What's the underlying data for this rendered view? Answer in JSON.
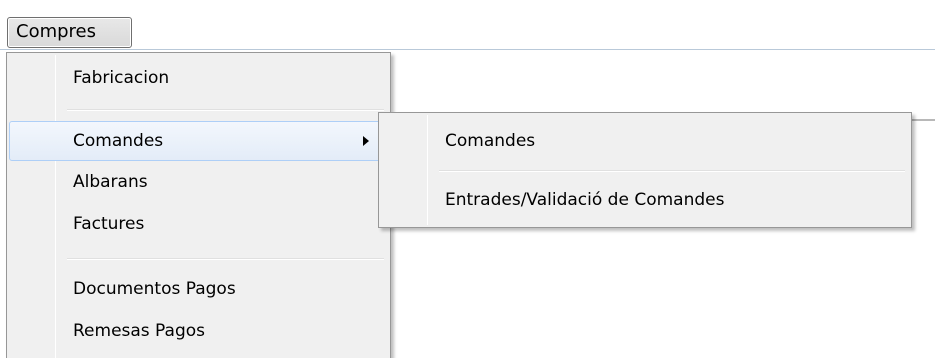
{
  "menubar": {
    "items": [
      {
        "label": "Compres"
      }
    ]
  },
  "dropdown": {
    "items": [
      {
        "label": "Fabricacion"
      },
      {
        "label": "Comandes",
        "has_submenu": true,
        "highlighted": true
      },
      {
        "label": "Albarans"
      },
      {
        "label": "Factures"
      },
      {
        "label": "Documentos Pagos"
      },
      {
        "label": "Remesas Pagos"
      }
    ]
  },
  "submenu": {
    "items": [
      {
        "label": "Comandes"
      },
      {
        "label": "Entrades/Validació de Comandes"
      }
    ]
  },
  "colors": {
    "menu_background": "#f0f0f0",
    "highlight_border": "#aecff7",
    "highlight_fill": "#e3ecf8"
  }
}
